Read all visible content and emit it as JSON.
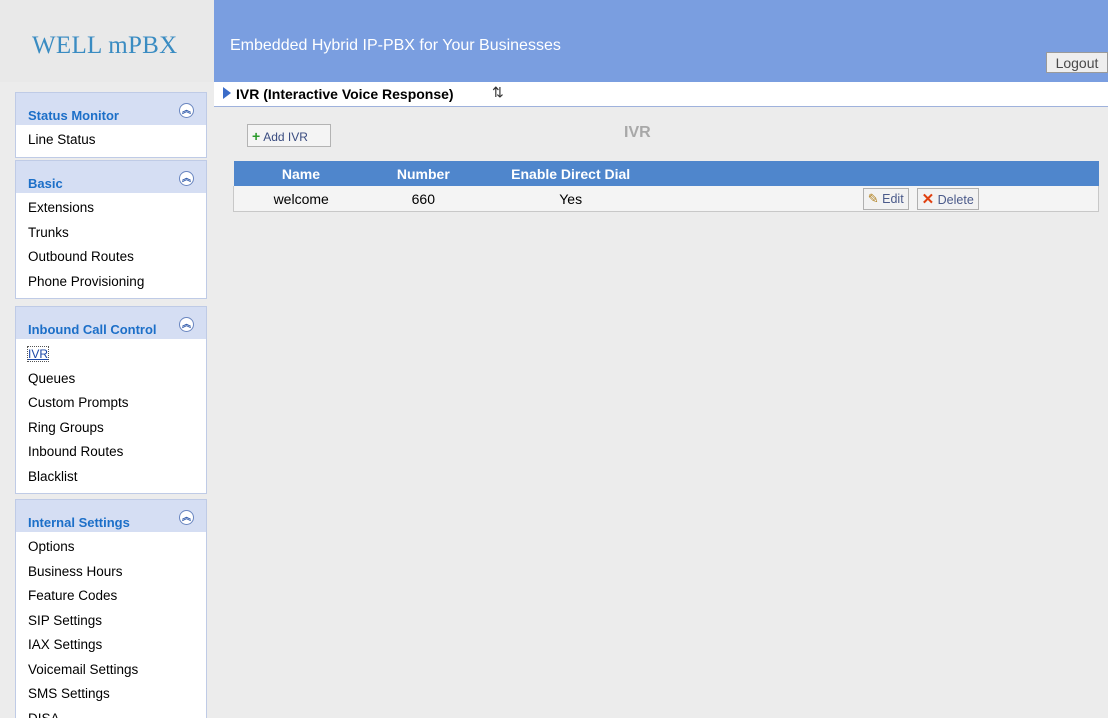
{
  "header": {
    "logo": "WELL mPBX",
    "tagline": "Embedded Hybrid IP-PBX for Your Businesses",
    "logout_label": "Logout",
    "banner_color": "#7a9ee0"
  },
  "sidebar": {
    "groups": [
      {
        "title": "Status Monitor",
        "items": [
          "Line Status"
        ]
      },
      {
        "title": "Basic",
        "items": [
          "Extensions",
          "Trunks",
          "Outbound Routes",
          "Phone Provisioning"
        ]
      },
      {
        "title": "Inbound Call Control",
        "items": [
          "IVR",
          "Queues",
          "Custom Prompts",
          "Ring Groups",
          "Inbound Routes",
          "Blacklist"
        ]
      },
      {
        "title": "Internal Settings",
        "items": [
          "Options",
          "Business Hours",
          "Feature Codes",
          "SIP Settings",
          "IAX Settings",
          "Voicemail Settings",
          "SMS Settings",
          "DISA"
        ]
      }
    ],
    "active_item": "IVR"
  },
  "main": {
    "page_title": "IVR (Interactive Voice Response)",
    "add_button_label": "Add IVR",
    "section_title": "IVR",
    "table": {
      "headers": [
        "Name",
        "Number",
        "Enable Direct Dial"
      ],
      "rows": [
        {
          "name": "welcome",
          "number": "660",
          "direct_dial": "Yes"
        }
      ],
      "edit_label": "Edit",
      "delete_label": "Delete",
      "header_color": "#4f86cc"
    }
  }
}
